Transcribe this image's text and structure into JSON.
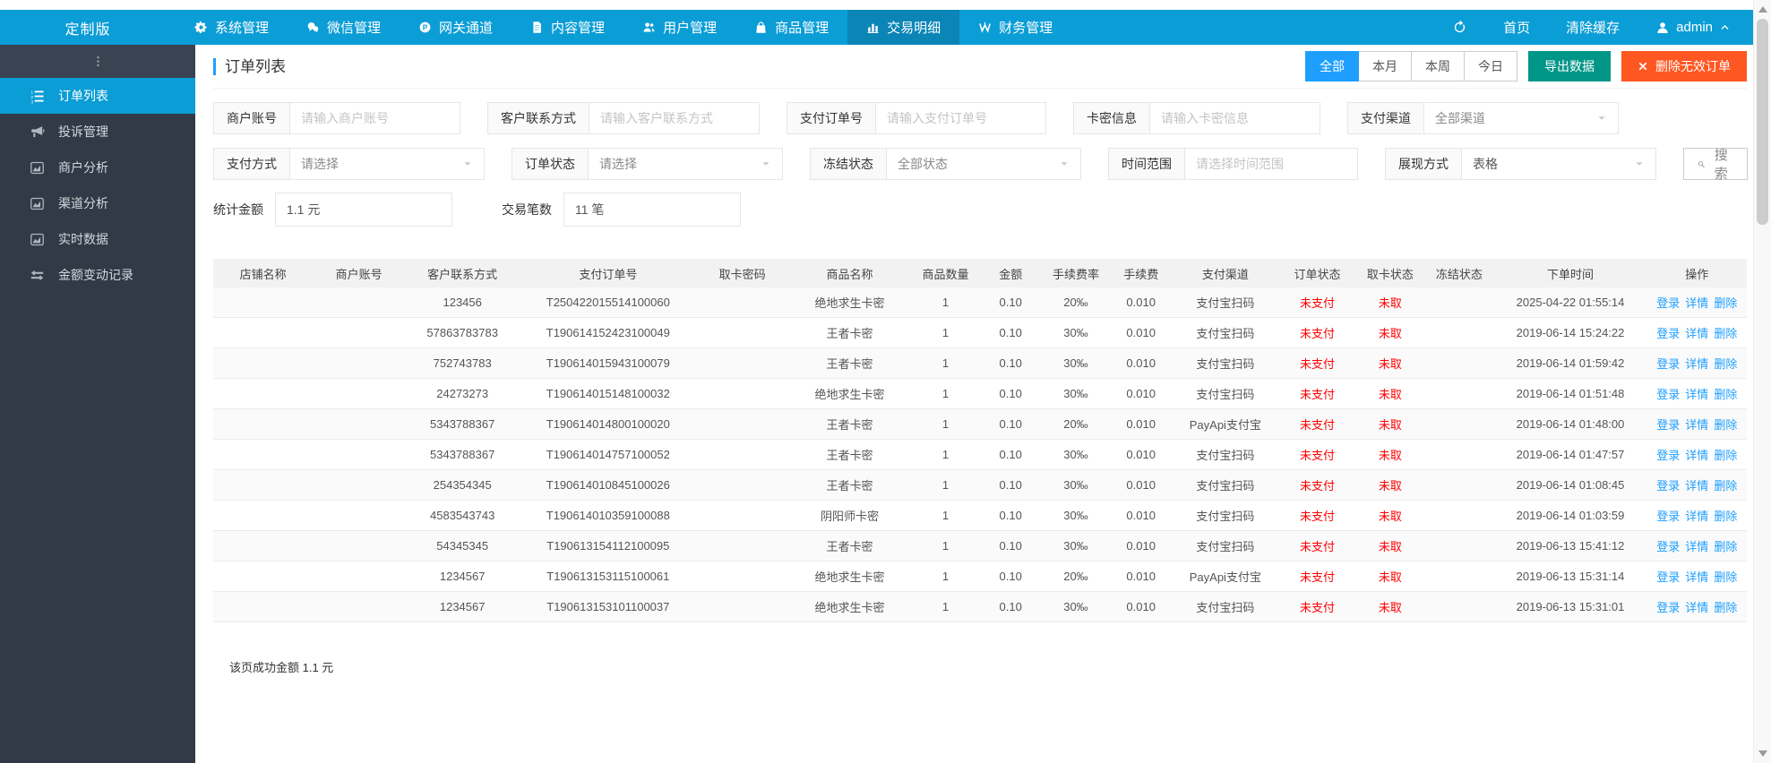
{
  "brand": "定制版",
  "topnav": {
    "items": [
      {
        "label": "系统管理",
        "icon": "gear",
        "name": "nav-item-system"
      },
      {
        "label": "微信管理",
        "icon": "wechat",
        "name": "nav-item-wechat"
      },
      {
        "label": "网关通道",
        "icon": "gateway",
        "name": "nav-item-gateway"
      },
      {
        "label": "内容管理",
        "icon": "doc",
        "name": "nav-item-content"
      },
      {
        "label": "用户管理",
        "icon": "users",
        "name": "nav-item-users"
      },
      {
        "label": "商品管理",
        "icon": "bag",
        "name": "nav-item-goods"
      },
      {
        "label": "交易明细",
        "icon": "chart",
        "name": "nav-item-transactions",
        "active": true
      },
      {
        "label": "财务管理",
        "icon": "finance",
        "name": "nav-item-finance"
      }
    ],
    "home": "首页",
    "clear_cache": "清除缓存",
    "user": "admin"
  },
  "sidebar": {
    "items": [
      {
        "label": "订单列表",
        "icon": "list-ol",
        "name": "sidebar-item-order-list",
        "active": true
      },
      {
        "label": "投诉管理",
        "icon": "megaphone",
        "name": "sidebar-item-complaints"
      },
      {
        "label": "商户分析",
        "icon": "area-chart",
        "name": "sidebar-item-merchant-analysis"
      },
      {
        "label": "渠道分析",
        "icon": "area-chart",
        "name": "sidebar-item-channel-analysis"
      },
      {
        "label": "实时数据",
        "icon": "area-chart",
        "name": "sidebar-item-realtime-data"
      },
      {
        "label": "金额变动记录",
        "icon": "exchange",
        "name": "sidebar-item-amount-change-log"
      }
    ]
  },
  "page": {
    "title": "订单列表",
    "range_buttons": [
      "全部",
      "本月",
      "本周",
      "今日"
    ],
    "active_range": "全部",
    "export_button": "导出数据",
    "delete_button": "删除无效订单",
    "search_button": "搜 索",
    "filters_row1": [
      {
        "label": "商户账号",
        "placeholder": "请输入商户账号",
        "type": "input"
      },
      {
        "label": "客户联系方式",
        "placeholder": "请输入客户联系方式",
        "type": "input"
      },
      {
        "label": "支付订单号",
        "placeholder": "请输入支付订单号",
        "type": "input"
      },
      {
        "label": "卡密信息",
        "placeholder": "请输入卡密信息",
        "type": "input"
      },
      {
        "label": "支付渠道",
        "value": "全部渠道",
        "type": "select"
      }
    ],
    "filters_row2": [
      {
        "label": "支付方式",
        "value": "请选择",
        "type": "select"
      },
      {
        "label": "订单状态",
        "value": "请选择",
        "type": "select"
      },
      {
        "label": "冻结状态",
        "value": "全部状态",
        "type": "select"
      },
      {
        "label": "时间范围",
        "placeholder": "请选择时间范围",
        "type": "input"
      },
      {
        "label": "展现方式",
        "value": "表格",
        "type": "select"
      }
    ],
    "stats": [
      {
        "label": "统计金额",
        "value": "1.1 元"
      },
      {
        "label": "交易笔数",
        "value": "11 笔"
      }
    ],
    "footer_note": "该页成功金额 1.1 元"
  },
  "table": {
    "headers": [
      "店铺名称",
      "商户账号",
      "客户联系方式",
      "支付订单号",
      "取卡密码",
      "商品名称",
      "商品数量",
      "金额",
      "手续费率",
      "手续费",
      "支付渠道",
      "订单状态",
      "取卡状态",
      "冻结状态",
      "下单时间",
      "操作"
    ],
    "action_labels": [
      "登录",
      "详情",
      "删除"
    ],
    "rows": [
      {
        "store": "",
        "merchant": "",
        "contact": "123456",
        "order_no": "T250422015514100060",
        "card_pwd": "",
        "product": "绝地求生卡密",
        "qty": "1",
        "amount": "0.10",
        "fee_rate": "20‰",
        "fee": "0.010",
        "channel": "支付宝扫码",
        "order_status": "未支付",
        "card_status": "未取",
        "freeze": "",
        "time": "2025-04-22 01:55:14"
      },
      {
        "store": "",
        "merchant": "",
        "contact": "57863783783",
        "order_no": "T190614152423100049",
        "card_pwd": "",
        "product": "王者卡密",
        "qty": "1",
        "amount": "0.10",
        "fee_rate": "30‰",
        "fee": "0.010",
        "channel": "支付宝扫码",
        "order_status": "未支付",
        "card_status": "未取",
        "freeze": "",
        "time": "2019-06-14 15:24:22"
      },
      {
        "store": "",
        "merchant": "",
        "contact": "752743783",
        "order_no": "T190614015943100079",
        "card_pwd": "",
        "product": "王者卡密",
        "qty": "1",
        "amount": "0.10",
        "fee_rate": "30‰",
        "fee": "0.010",
        "channel": "支付宝扫码",
        "order_status": "未支付",
        "card_status": "未取",
        "freeze": "",
        "time": "2019-06-14 01:59:42"
      },
      {
        "store": "",
        "merchant": "",
        "contact": "24273273",
        "order_no": "T190614015148100032",
        "card_pwd": "",
        "product": "绝地求生卡密",
        "qty": "1",
        "amount": "0.10",
        "fee_rate": "30‰",
        "fee": "0.010",
        "channel": "支付宝扫码",
        "order_status": "未支付",
        "card_status": "未取",
        "freeze": "",
        "time": "2019-06-14 01:51:48"
      },
      {
        "store": "",
        "merchant": "",
        "contact": "5343788367",
        "order_no": "T190614014800100020",
        "card_pwd": "",
        "product": "王者卡密",
        "qty": "1",
        "amount": "0.10",
        "fee_rate": "20‰",
        "fee": "0.010",
        "channel": "PayApi支付宝",
        "order_status": "未支付",
        "card_status": "未取",
        "freeze": "",
        "time": "2019-06-14 01:48:00"
      },
      {
        "store": "",
        "merchant": "",
        "contact": "5343788367",
        "order_no": "T190614014757100052",
        "card_pwd": "",
        "product": "王者卡密",
        "qty": "1",
        "amount": "0.10",
        "fee_rate": "30‰",
        "fee": "0.010",
        "channel": "支付宝扫码",
        "order_status": "未支付",
        "card_status": "未取",
        "freeze": "",
        "time": "2019-06-14 01:47:57"
      },
      {
        "store": "",
        "merchant": "",
        "contact": "254354345",
        "order_no": "T190614010845100026",
        "card_pwd": "",
        "product": "王者卡密",
        "qty": "1",
        "amount": "0.10",
        "fee_rate": "30‰",
        "fee": "0.010",
        "channel": "支付宝扫码",
        "order_status": "未支付",
        "card_status": "未取",
        "freeze": "",
        "time": "2019-06-14 01:08:45"
      },
      {
        "store": "",
        "merchant": "",
        "contact": "4583543743",
        "order_no": "T190614010359100088",
        "card_pwd": "",
        "product": "阴阳师卡密",
        "qty": "1",
        "amount": "0.10",
        "fee_rate": "30‰",
        "fee": "0.010",
        "channel": "支付宝扫码",
        "order_status": "未支付",
        "card_status": "未取",
        "freeze": "",
        "time": "2019-06-14 01:03:59"
      },
      {
        "store": "",
        "merchant": "",
        "contact": "54345345",
        "order_no": "T190613154112100095",
        "card_pwd": "",
        "product": "王者卡密",
        "qty": "1",
        "amount": "0.10",
        "fee_rate": "30‰",
        "fee": "0.010",
        "channel": "支付宝扫码",
        "order_status": "未支付",
        "card_status": "未取",
        "freeze": "",
        "time": "2019-06-13 15:41:12"
      },
      {
        "store": "",
        "merchant": "",
        "contact": "1234567",
        "order_no": "T190613153115100061",
        "card_pwd": "",
        "product": "绝地求生卡密",
        "qty": "1",
        "amount": "0.10",
        "fee_rate": "20‰",
        "fee": "0.010",
        "channel": "PayApi支付宝",
        "order_status": "未支付",
        "card_status": "未取",
        "freeze": "",
        "time": "2019-06-13 15:31:14"
      },
      {
        "store": "",
        "merchant": "",
        "contact": "1234567",
        "order_no": "T190613153101100037",
        "card_pwd": "",
        "product": "绝地求生卡密",
        "qty": "1",
        "amount": "0.10",
        "fee_rate": "30‰",
        "fee": "0.010",
        "channel": "支付宝扫码",
        "order_status": "未支付",
        "card_status": "未取",
        "freeze": "",
        "time": "2019-06-13 15:31:01"
      }
    ]
  },
  "colors": {
    "navbar": "#0b9dd6",
    "navbar_active": "#0a85b6",
    "sidebar": "#313a46",
    "accent_blue": "#1E9FFF",
    "export_green": "#009688",
    "delete_orange": "#FF5722",
    "status_red": "#ff0000"
  }
}
